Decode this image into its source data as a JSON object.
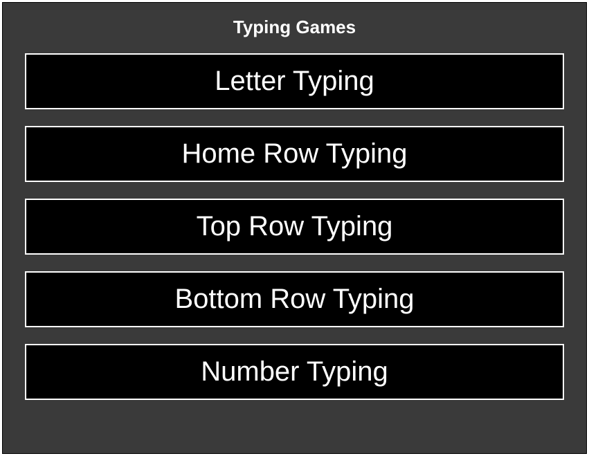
{
  "panel": {
    "title": "Typing Games",
    "games": [
      {
        "label": "Letter Typing"
      },
      {
        "label": "Home Row Typing"
      },
      {
        "label": "Top Row Typing"
      },
      {
        "label": "Bottom Row Typing"
      },
      {
        "label": "Number Typing"
      }
    ]
  }
}
